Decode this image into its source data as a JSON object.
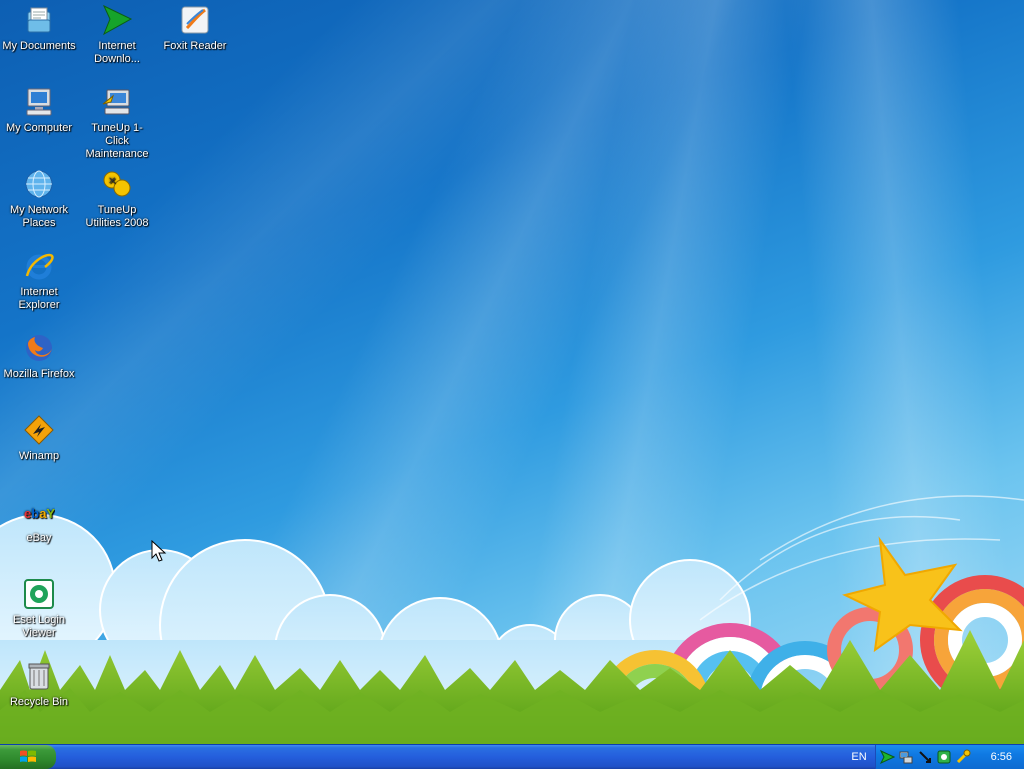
{
  "desktop": {
    "icons": [
      {
        "id": "my-documents",
        "label": "My Documents",
        "icon": "my-documents-icon"
      },
      {
        "id": "my-computer",
        "label": "My Computer",
        "icon": "my-computer-icon"
      },
      {
        "id": "my-network-places",
        "label": "My Network Places",
        "icon": "network-globe-icon"
      },
      {
        "id": "internet-explorer",
        "label": "Internet Explorer",
        "icon": "internet-explorer-icon"
      },
      {
        "id": "mozilla-firefox",
        "label": "Mozilla Firefox",
        "icon": "firefox-icon"
      },
      {
        "id": "winamp",
        "label": "Winamp",
        "icon": "winamp-bolt-icon"
      },
      {
        "id": "ebay",
        "label": "eBay",
        "icon": "ebay-logo-icon"
      },
      {
        "id": "eset-login-viewer",
        "label": "Eset Login Viewer",
        "icon": "eset-icon"
      },
      {
        "id": "recycle-bin",
        "label": "Recycle Bin",
        "icon": "recycle-bin-icon"
      },
      {
        "id": "internet-download",
        "label": "Internet Downlo...",
        "icon": "green-arrow-icon"
      },
      {
        "id": "tuneup-1click",
        "label": "TuneUp 1-Click Maintenance",
        "icon": "tuneup-1click-icon"
      },
      {
        "id": "tuneup-utilities",
        "label": "TuneUp Utilities 2008",
        "icon": "tuneup-utilities-icon"
      },
      {
        "id": "foxit-reader",
        "label": "Foxit Reader",
        "icon": "foxit-reader-icon"
      }
    ]
  },
  "taskbar": {
    "start_icon": "windows-logo-icon",
    "language": "EN",
    "clock": "6:56",
    "tray_icons": [
      "green-arrow-tray-icon",
      "network-tray-icon",
      "cursor-tray-icon",
      "green-square-tray-icon",
      "tools-tray-icon"
    ]
  },
  "colors": {
    "taskbar": "#245edc",
    "start_button": "#3c9a3a",
    "tray": "#0f79e2"
  }
}
